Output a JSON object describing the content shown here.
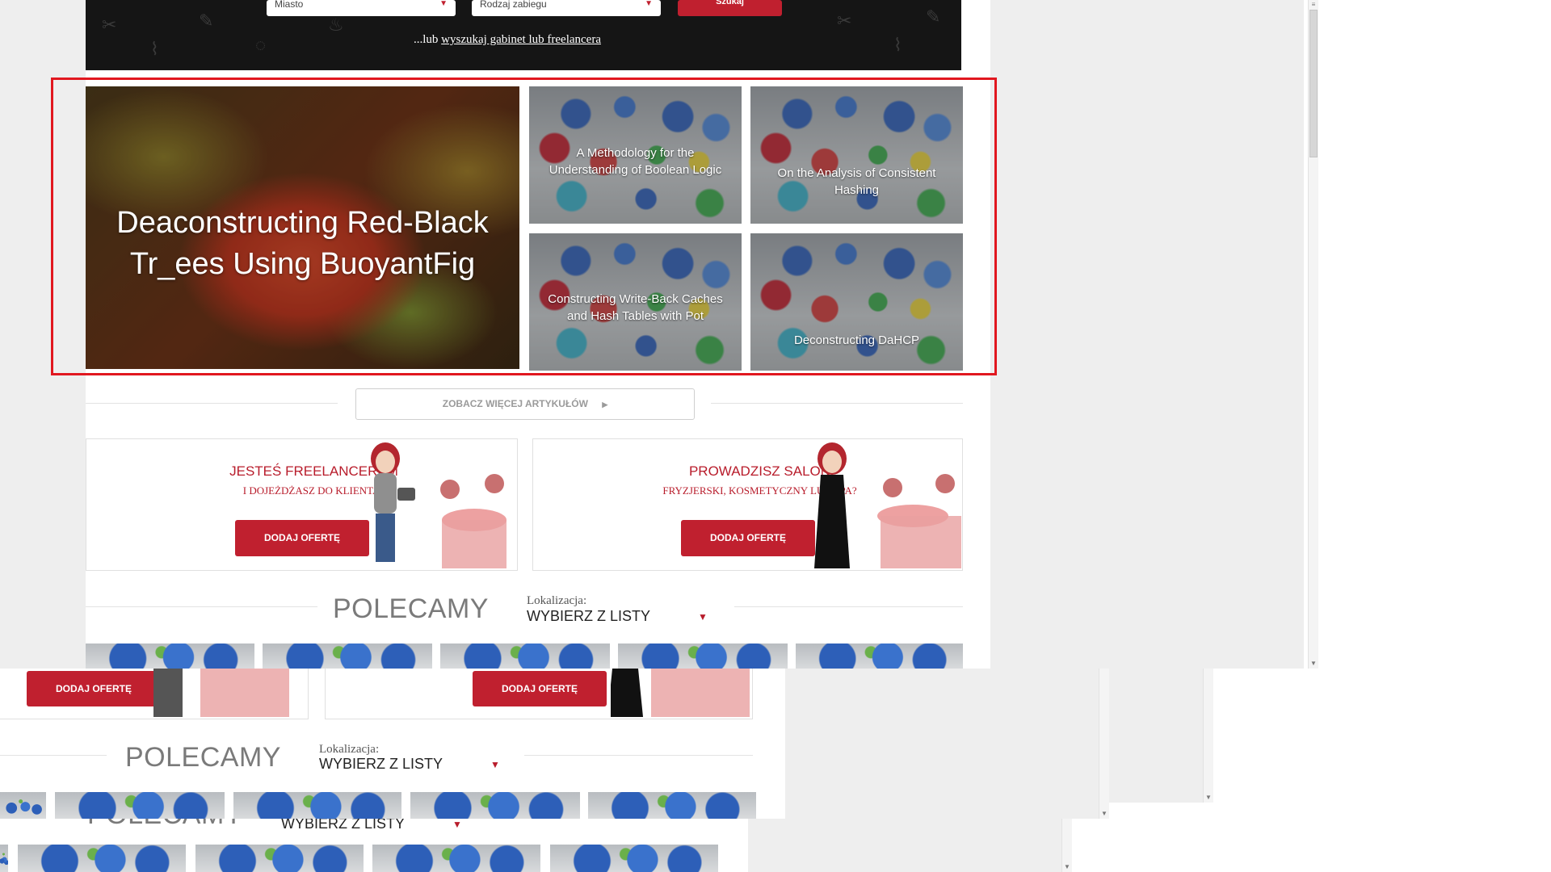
{
  "hero": {
    "city_placeholder": "Miasto",
    "treatment_placeholder": "Rodzaj zabiegu",
    "search_button": "Szukaj",
    "link_prefix": "...lub ",
    "link_text": "wyszukaj gabinet lub freelancera"
  },
  "articles": {
    "featured": {
      "title": "Deaconstructing Red-Black Tr_ees Using BuoyantFig"
    },
    "tiles": [
      {
        "title": "A Methodology for the Understanding of Boolean Logic"
      },
      {
        "title": "On the Analysis of Consistent Hashing"
      },
      {
        "title": "Constructing Write-Back Caches and Hash Tables with Pot"
      },
      {
        "title": "Deconstructing DaHCP"
      }
    ],
    "more_button": "ZOBACZ WIĘCEJ ARTYKUŁÓW"
  },
  "promos": [
    {
      "title": "JESTEŚ FREELANCEREM",
      "subtitle": "I DOJEŻDŻASZ DO KLIENTA?",
      "button": "DODAJ OFERTĘ"
    },
    {
      "title": "PROWADZISZ SALON",
      "subtitle": "FRYZJERSKI, KOSMETYCZNY LUB SPA?",
      "button": "DODAJ OFERTĘ"
    }
  ],
  "polecamy": {
    "heading": "POLECAMY",
    "location_label": "Lokalizacja:",
    "location_value": "WYBIERZ Z LISTY"
  },
  "colors": {
    "accent": "#c0202f",
    "highlight_frame": "#e1171f",
    "background_gray": "#eeeeee"
  },
  "icons": {
    "dropdown": "caret-down-icon",
    "more": "caret-right-icon"
  }
}
